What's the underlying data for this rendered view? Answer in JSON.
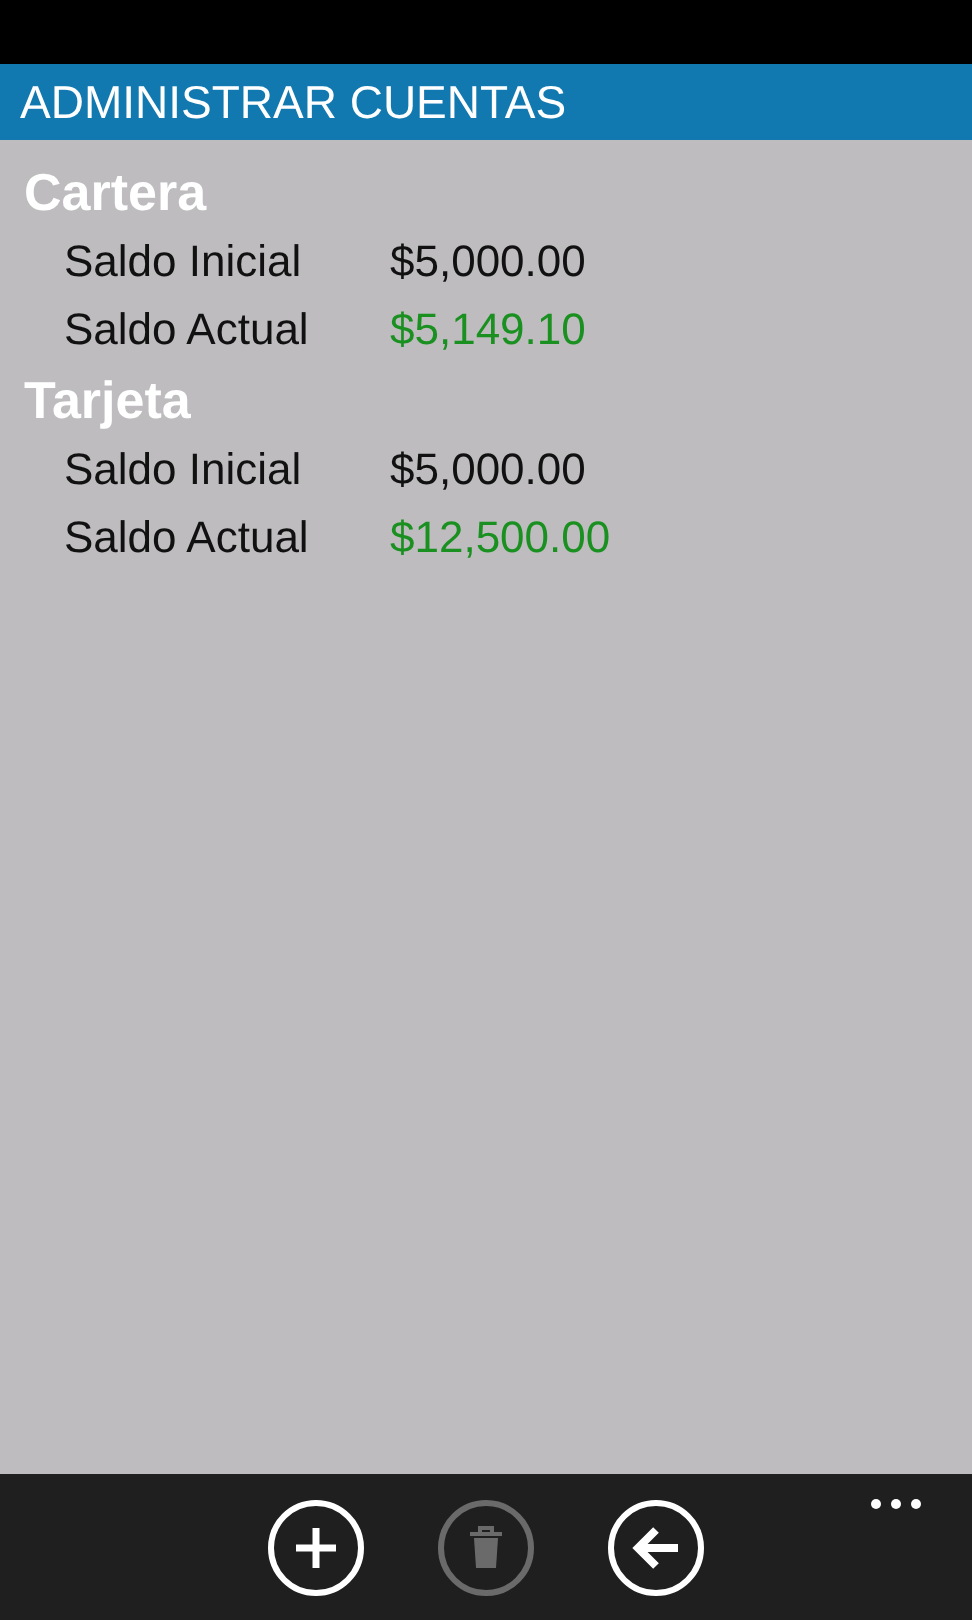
{
  "header": {
    "title": "ADMINISTRAR CUENTAS"
  },
  "accounts": [
    {
      "name": "Cartera",
      "rows": [
        {
          "label": "Saldo Inicial",
          "value": "$5,000.00",
          "highlight": false
        },
        {
          "label": "Saldo Actual",
          "value": "$5,149.10",
          "highlight": true
        }
      ]
    },
    {
      "name": "Tarjeta",
      "rows": [
        {
          "label": "Saldo Inicial",
          "value": "$5,000.00",
          "highlight": false
        },
        {
          "label": "Saldo Actual",
          "value": "$12,500.00",
          "highlight": true
        }
      ]
    }
  ],
  "app_bar": {
    "buttons": [
      {
        "kind": "add",
        "disabled": false
      },
      {
        "kind": "delete",
        "disabled": true
      },
      {
        "kind": "back",
        "disabled": false
      }
    ]
  }
}
